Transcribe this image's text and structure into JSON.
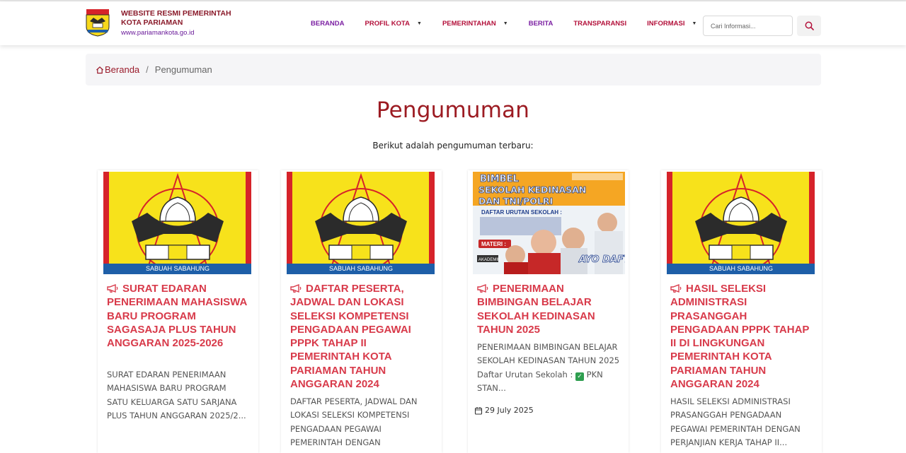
{
  "site": {
    "title_line1": "WEBSITE RESMI PEMERINTAH",
    "title_line2": "KOTA PARIAMAN",
    "url": "www.pariamankota.go.id"
  },
  "nav": {
    "beranda": "BERANDA",
    "profil_kota": "PROFIL KOTA",
    "pemerintahan": "PEMERINTAHAN",
    "berita": "BERITA",
    "transparansi": "TRANSPARANSI",
    "informasi": "INFORMASI",
    "search_placeholder": "Cari Informasi..."
  },
  "breadcrumb": {
    "home": "Beranda",
    "separator": "/",
    "current": "Pengumuman"
  },
  "page": {
    "title": "Pengumuman",
    "subtitle": "Berikut adalah pengumuman terbaru:"
  },
  "cards": [
    {
      "title": "SURAT EDARAN PENERIMAAN MAHASISWA BARU PROGRAM SAGASAJA PLUS TAHUN ANGGARAN 2025-2026",
      "excerpt": "SURAT EDARAN PENERIMAAN MAHASISWA BARU PROGRAM SATU KELUARGA SATU SARJANA PLUS TAHUN ANGGARAN 2025/2...",
      "image": "kota-pariaman-emblem",
      "logo_banner": "SABUAH SABAHUNG"
    },
    {
      "title": "DAFTAR PESERTA, JADWAL DAN LOKASI SELEKSI KOMPETENSI PENGADAAN PEGAWAI PPPK TAHAP II PEMERINTAH KOTA PARIAMAN TAHUN ANGGARAN 2024",
      "excerpt": "DAFTAR PESERTA, JADWAL DAN LOKASI SELEKSI KOMPETENSI PENGADAAN PEGAWAI PEMERINTAH DENGAN",
      "image": "kota-pariaman-emblem",
      "logo_banner": "SABUAH SABAHUNG"
    },
    {
      "title": "PENERIMAAN BIMBINGAN BELAJAR SEKOLAH KEDINASAN TAHUN 2025",
      "excerpt_before": "PENERIMAAN BIMBINGAN BELAJAR SEKOLAH KEDINASAN TAHUN 2025 Daftar Urutan Sekolah :",
      "excerpt_after": "PKN STAN...",
      "date": "29 July 2025",
      "image": "bimbel-poster",
      "poster": {
        "line1": "BIMBEL",
        "line2": "SEKOLAH KEDINASAN",
        "line3": "DAN TNI/POLRI",
        "list_title": "DAFTAR URUTAN SEKOLAH :",
        "materi": "MATERI :",
        "akademik": "AKADEMIK",
        "cta": "AYO DAFTAR!!"
      }
    },
    {
      "title": "HASIL SELEKSI ADMINISTRASI PRASANGGAH PENGADAAN PPPK TAHAP II DI LINGKUNGAN PEMERINTAH KOTA PARIAMAN TAHUN ANGGARAN 2024",
      "excerpt": "HASIL SELEKSI ADMINISTRASI PRASANGGAH PENGADAAN PEGAWAI PEMERINTAH DENGAN PERJANJIAN KERJA TAHAP II...",
      "image": "kota-pariaman-emblem",
      "logo_banner": "SABUAH SABAHUNG"
    }
  ],
  "colors": {
    "accent_red": "#9c1b22",
    "card_title": "#d83a4a",
    "nav_purple": "#7b1fa2",
    "emblem_yellow": "#f7e21b"
  }
}
